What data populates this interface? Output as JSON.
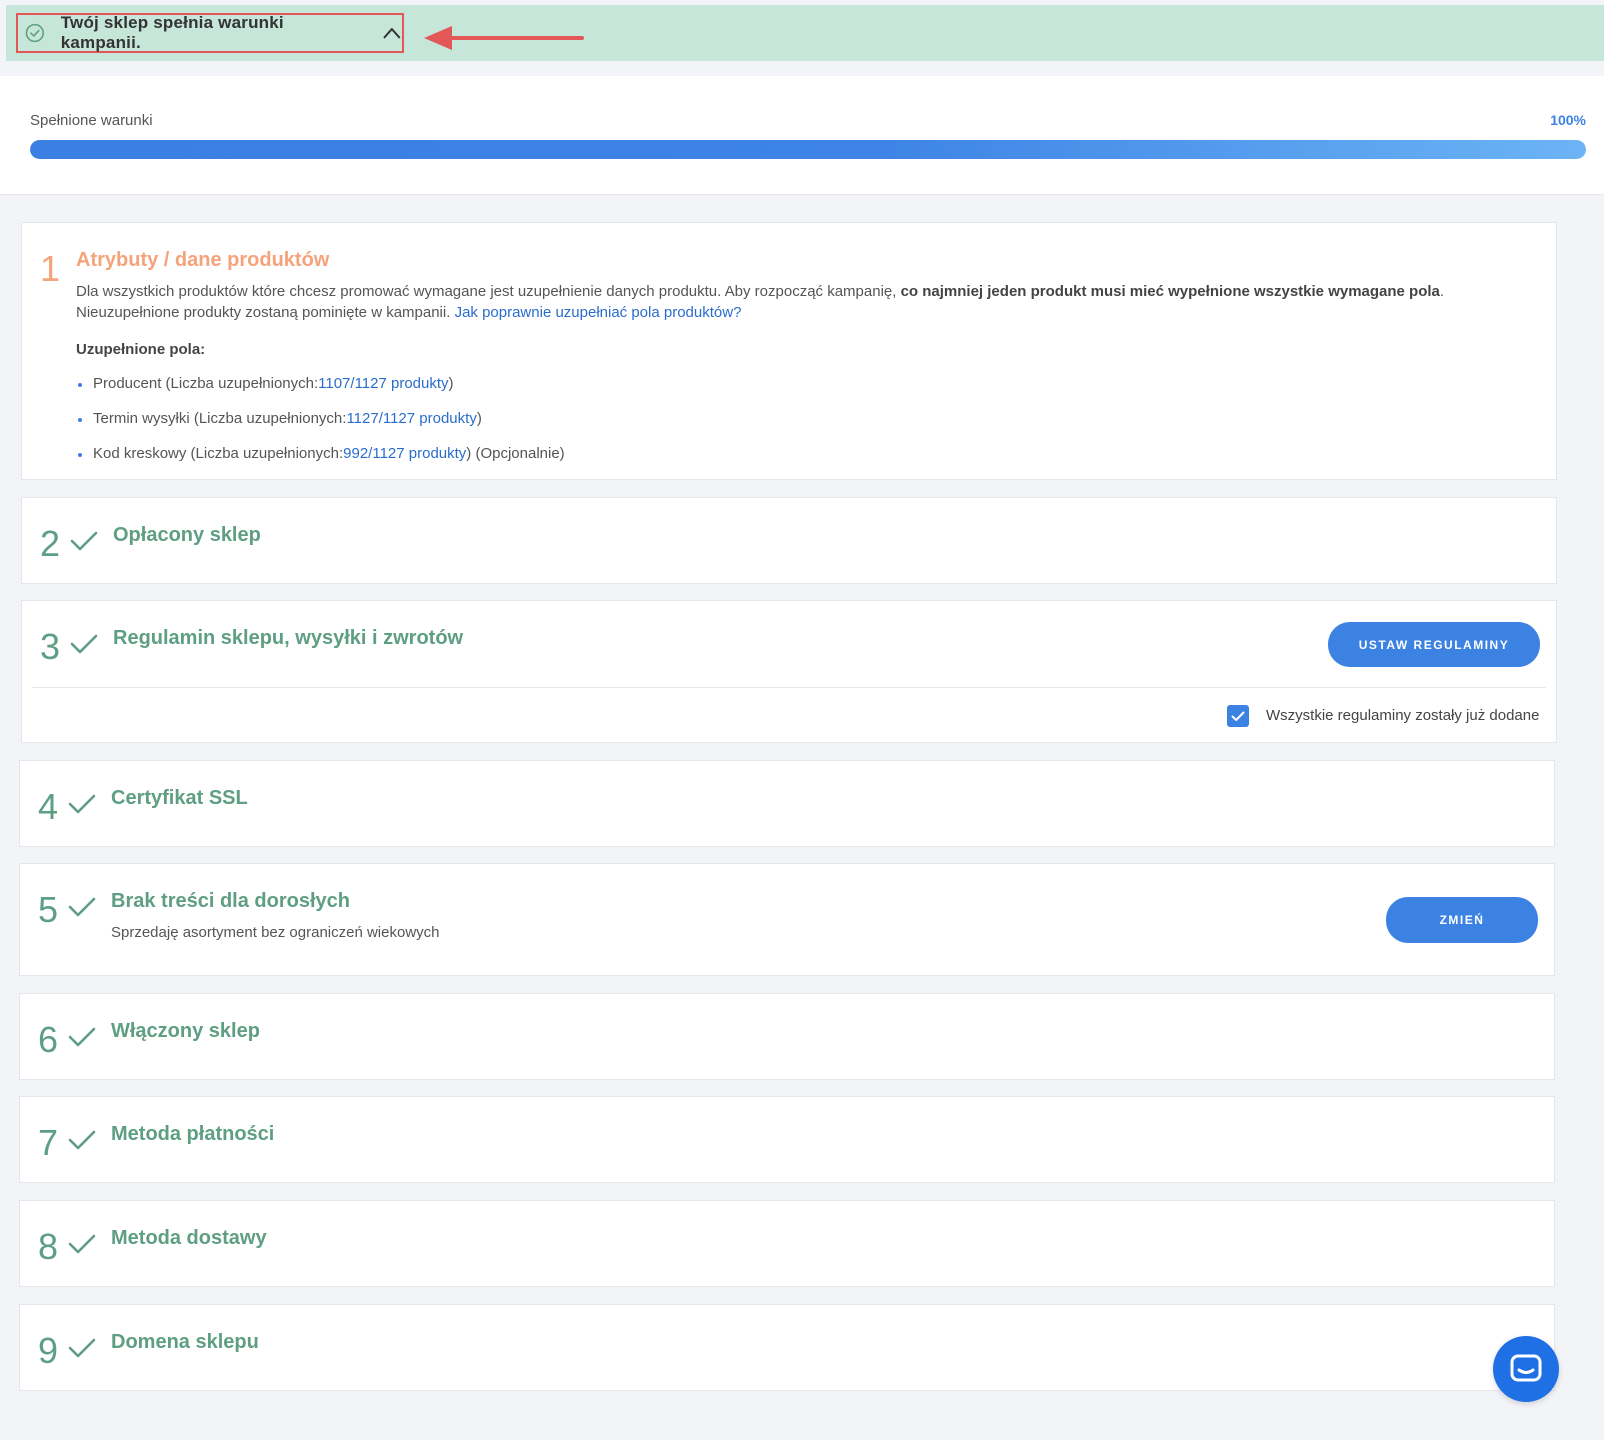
{
  "banner": {
    "text": "Twój sklep spełnia warunki kampanii."
  },
  "progress": {
    "label": "Spełnione warunki",
    "value_text": "100%",
    "fraction": 1.0
  },
  "steps": {
    "s1": {
      "number": "1",
      "title": "Atrybuty / dane produktów",
      "desc_part1": "Dla wszystkich produktów które chcesz promować wymagane jest uzupełnienie danych produktu. Aby rozpocząć kampanię, ",
      "desc_bold": "co najmniej jeden produkt musi mieć wypełnione wszystkie wymagane pola",
      "desc_part2": ". Nieuzupełnione produkty zostaną pominięte w kampanii. ",
      "help_link": "Jak poprawnie uzupełniać pola produktów?",
      "filled_label": "Uzupełnione pola:",
      "fields": [
        {
          "prefix": "Producent (Liczba uzupełnionych:",
          "link": "1107/1127 produkty",
          "suffix": ")"
        },
        {
          "prefix": "Termin wysyłki (Liczba uzupełnionych:",
          "link": "1127/1127 produkty",
          "suffix": ")"
        },
        {
          "prefix": "Kod kreskowy (Liczba uzupełnionych:",
          "link": "992/1127 produkty",
          "suffix": ") (Opcjonalnie)"
        }
      ]
    },
    "s2": {
      "number": "2",
      "title": "Opłacony sklep"
    },
    "s3": {
      "number": "3",
      "title": "Regulamin sklepu, wysyłki i zwrotów",
      "button": "USTAW REGULAMINY",
      "checkbox_label": "Wszystkie regulaminy zostały już dodane",
      "checked": true
    },
    "s4": {
      "number": "4",
      "title": "Certyfikat SSL"
    },
    "s5": {
      "number": "5",
      "title": "Brak treści dla dorosłych",
      "subtitle": "Sprzedaję asortyment bez ograniczeń wiekowych",
      "button": "ZMIEŃ"
    },
    "s6": {
      "number": "6",
      "title": "Włączony sklep"
    },
    "s7": {
      "number": "7",
      "title": "Metoda płatności"
    },
    "s8": {
      "number": "8",
      "title": "Metoda dostawy"
    },
    "s9": {
      "number": "9",
      "title": "Domena sklepu"
    }
  },
  "icons": {
    "banner": "check-circle-icon",
    "toggle": "chevron-up-icon",
    "step": "checkmark-icon",
    "chat": "chat-icon"
  },
  "colors": {
    "banner_bg": "#c6e6d9",
    "accent_blue": "#3b82e3",
    "success_green": "#5e9e83",
    "warning_orange": "#f5a37a",
    "annotation_red": "#e35757"
  }
}
